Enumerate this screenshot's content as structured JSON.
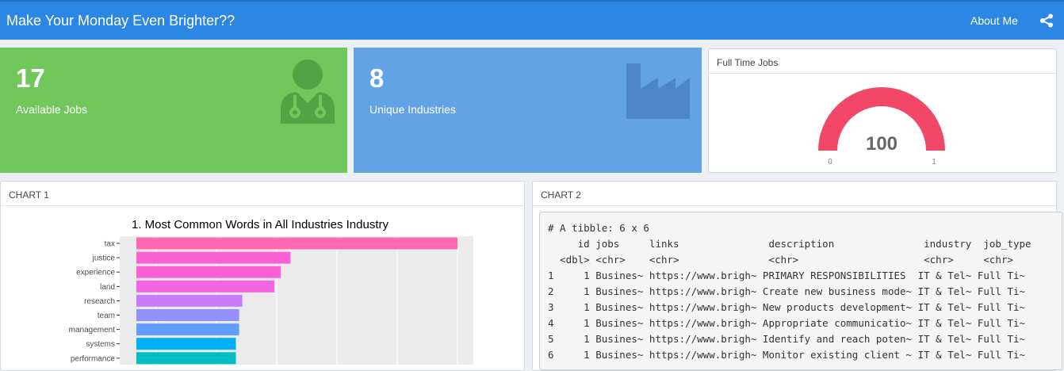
{
  "header": {
    "title": "Make Your Monday Even Brighter??",
    "about_label": "About Me",
    "share_icon": "share-icon"
  },
  "value_boxes": [
    {
      "value": "17",
      "label": "Available Jobs",
      "color": "#72c75c",
      "icon": "user-doctor-icon"
    },
    {
      "value": "8",
      "label": "Unique Industries",
      "color": "#63a2e5",
      "icon": "industry-icon"
    }
  ],
  "gauge_box": {
    "title": "Full Time Jobs",
    "value": "100",
    "min": "0",
    "max": "1",
    "fill_fraction": 1.0,
    "color": "#f14868"
  },
  "chart1": {
    "header": "CHART 1",
    "chart_data": {
      "type": "bar",
      "orientation": "horizontal",
      "title": "1. Most Common Words in All Industries Industry",
      "categories": [
        "tax",
        "justice",
        "experience",
        "land",
        "research",
        "team",
        "management",
        "systems",
        "performance"
      ],
      "values": [
        100,
        48,
        45,
        43,
        33,
        32,
        32,
        31,
        31
      ],
      "colors": [
        "#ff69b1",
        "#fb61d7",
        "#fb61d7",
        "#f564e3",
        "#c77cff",
        "#9590ff",
        "#619cff",
        "#00b0f6",
        "#00bfc4"
      ],
      "xlim": [
        0,
        103
      ],
      "grid": true
    }
  },
  "chart2": {
    "header": "CHART 2",
    "tibble_lines": [
      "# A tibble: 6 x 6",
      "     id jobs     links               description               industry  job_type",
      "  <dbl> <chr>    <chr>               <chr>                     <chr>     <chr>",
      "1     1 Busines~ https://www.brigh~ PRIMARY RESPONSIBILITIES  IT & Tel~ Full Ti~",
      "2     1 Busines~ https://www.brigh~ Create new business mode~ IT & Tel~ Full Ti~",
      "3     1 Busines~ https://www.brigh~ New products development~ IT & Tel~ Full Ti~",
      "4     1 Busines~ https://www.brigh~ Appropriate communicatio~ IT & Tel~ Full Ti~",
      "5     1 Busines~ https://www.brigh~ Identify and reach poten~ IT & Tel~ Full Ti~",
      "6     1 Busines~ https://www.brigh~ Monitor existing client ~ IT & Tel~ Full Ti~"
    ]
  }
}
